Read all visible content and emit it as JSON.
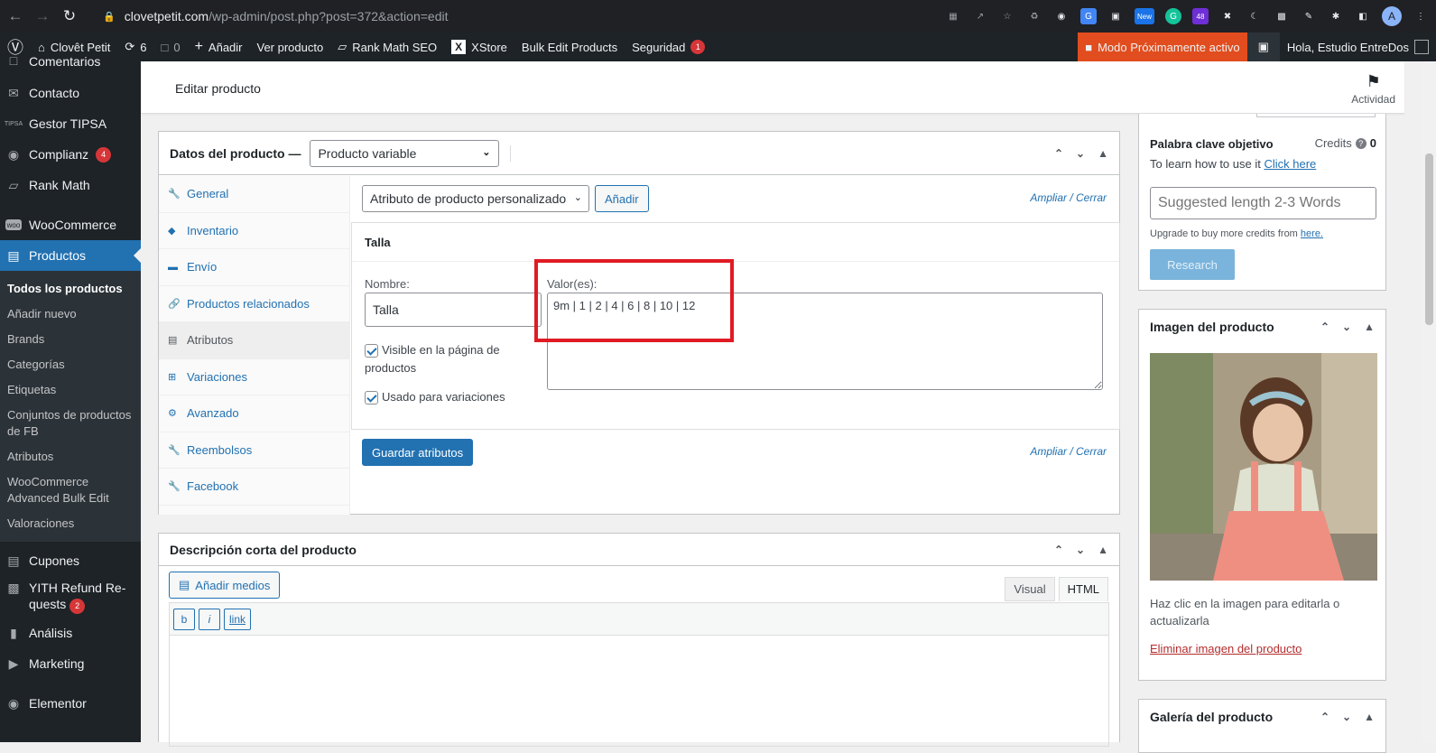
{
  "browser": {
    "url_host": "clovetpetit.com",
    "url_path": "/wp-admin/post.php?post=372&action=edit",
    "ext_badges": {
      "new": "New",
      "count": "48"
    },
    "avatar_letter": "A"
  },
  "adminbar": {
    "site_name": "Clovêt Petit",
    "updates": "6",
    "comments": "0",
    "add_new": "Añadir",
    "view_product": "Ver producto",
    "rank_math": "Rank Math SEO",
    "xstore": "XStore",
    "bulk_edit": "Bulk Edit Products",
    "security": "Seguridad",
    "security_count": "1",
    "coming_soon": "Modo Próximamente activo",
    "greeting": "Hola, Estudio EntreDos"
  },
  "sidebar": {
    "items": [
      {
        "label": "Comentarios"
      },
      {
        "label": "Contacto"
      },
      {
        "label": "Gestor TIPSA"
      },
      {
        "label": "Complianz",
        "badge": "4"
      },
      {
        "label": "Rank Math"
      },
      {
        "label": "WooCommerce"
      },
      {
        "label": "Productos"
      }
    ],
    "sub_items": [
      "Todos los productos",
      "Añadir nuevo",
      "Brands",
      "Categorías",
      "Etiquetas",
      "Conjuntos de productos de FB",
      "Atributos",
      "WooCommerce Advanced Bulk Edit",
      "Valoraciones"
    ],
    "bottom_items": [
      {
        "label": "Cupones"
      },
      {
        "label": "YITH Refund Re-quests",
        "badge": "2"
      },
      {
        "label": "Análisis"
      },
      {
        "label": "Marketing"
      },
      {
        "label": "Elementor"
      }
    ]
  },
  "header": {
    "title": "Editar producto",
    "activity": "Actividad"
  },
  "product_data": {
    "title": "Datos del producto —",
    "product_type": "Producto variable",
    "tabs": [
      "General",
      "Inventario",
      "Envío",
      "Productos relacionados",
      "Atributos",
      "Variaciones",
      "Avanzado",
      "Reembolsos",
      "Facebook"
    ],
    "attribute_select": "Atributo de producto personalizado",
    "add_button": "Añadir",
    "expand_close": "Ampliar / Cerrar",
    "attribute": {
      "heading": "Talla",
      "name_label": "Nombre:",
      "name_value": "Talla",
      "values_label": "Valor(es):",
      "values_value": "9m | 1 | 2 | 4 | 6 | 8 | 10 | 12",
      "visible_label": "Visible en la página de productos",
      "variations_label": "Usado para variaciones"
    },
    "save_button": "Guardar atributos"
  },
  "short_description": {
    "title": "Descripción corta del producto",
    "add_media": "Añadir medios",
    "tab_visual": "Visual",
    "tab_html": "HTML",
    "quicktags": [
      "b",
      "i",
      "link"
    ]
  },
  "rankmath": {
    "focus_label": "Palabra clave objetivo",
    "credits_label": "Credits",
    "credits_value": "0",
    "learn_text": "To learn how to use it",
    "learn_link": "Click here",
    "placeholder": "Suggested length 2-3 Words",
    "upgrade_text": "Upgrade to buy more credits from",
    "upgrade_link": "here.",
    "research_button": "Research"
  },
  "product_image": {
    "title": "Imagen del producto",
    "hint": "Haz clic en la imagen para editarla o actualizarla",
    "remove_link": "Eliminar imagen del producto"
  },
  "gallery": {
    "title": "Galería del producto"
  },
  "colors": {
    "admin_dark": "#1d2327",
    "primary": "#2271b1",
    "highlight_red": "#e01b24",
    "coming_soon_orange": "#e14d1e"
  }
}
